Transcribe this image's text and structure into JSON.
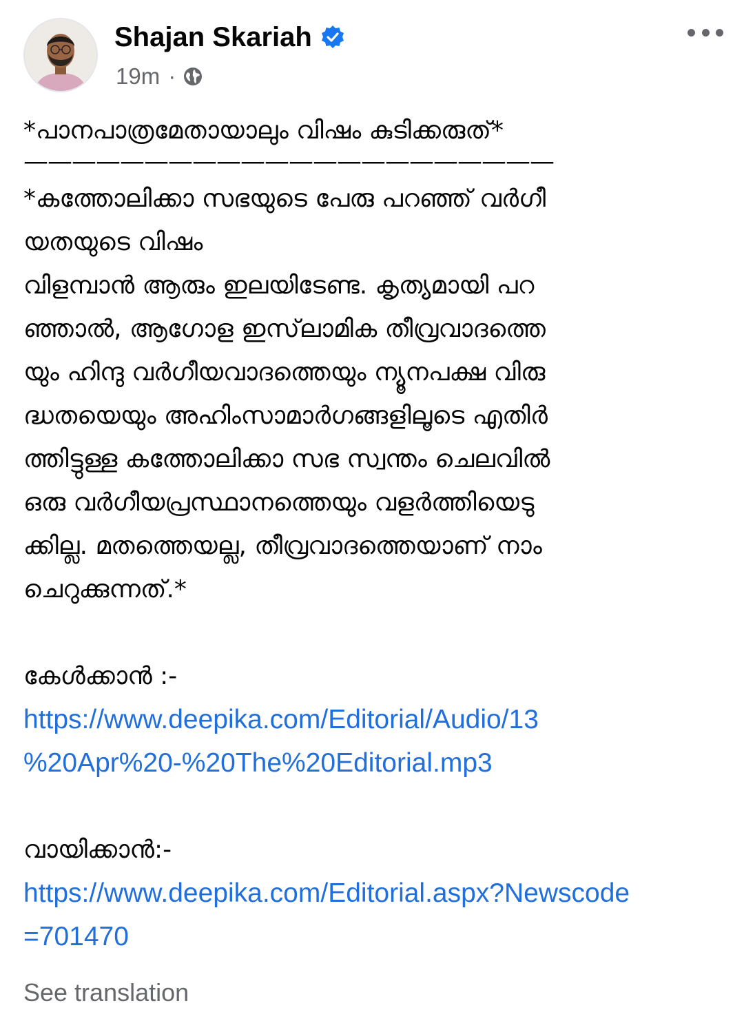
{
  "header": {
    "author_name": "Shajan Skariah",
    "timestamp": "19m",
    "separator": "·",
    "verified_color": "#1877f2",
    "privacy_icon": "globe-icon",
    "more_icon": "more-options-icon"
  },
  "post": {
    "title_line": "*പാനപാത്രമേതായാലും വിഷം കുടിക്കരുത്*",
    "divider": "——————————————————————",
    "body": "*കത്തോലിക്കാ സഭയുടെ പേരു പറഞ്ഞ് വർഗീ\nയതയുടെ വിഷം\nവിളമ്പാൻ ആരും ഇലയിടേണ്ട. കൃത്യമായി പറ\nഞ്ഞാൽ, ആഗോള ഇസ്‌ലാമിക തീവ്രവാദത്തെ\nയും ഹിന്ദു വർഗീയവാദത്തെയും ന്യൂനപക്ഷ വിരു\nദ്ധതയെയും അഹിംസാമാർഗങ്ങളിലൂടെ എതിർ\nത്തിട്ടുള്ള കത്തോലിക്കാ സഭ സ്വന്തം ചെലവിൽ\nഒരു വർഗീയപ്രസ്ഥാനത്തെയും വളർത്തിയെടു\nക്കില്ല. മതത്തെയല്ല, തീവ്രവാദത്തെയാണ് നാം\nചെറുക്കുന്നത്.*",
    "listen_label": "കേൾക്കാൻ :-",
    "listen_link": "https://www.deepika.com/Editorial/Audio/13\n%20Apr%20-%20The%20Editorial.mp3",
    "read_label": "വായിക്കാൻ:-",
    "read_link": "https://www.deepika.com/Editorial.aspx?Newscode\n=701470",
    "link_color": "#216fdb"
  },
  "footer": {
    "see_translation": "See translation"
  }
}
